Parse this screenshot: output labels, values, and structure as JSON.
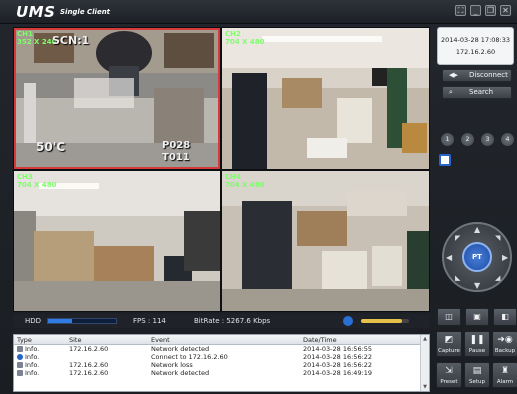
{
  "app": {
    "title": "UMS",
    "subtitle": "Single Client"
  },
  "window_controls": [
    {
      "name": "fullscreen-button",
      "glyph": "⛶"
    },
    {
      "name": "minimize-button",
      "glyph": "_"
    },
    {
      "name": "restore-button",
      "glyph": "❐"
    },
    {
      "name": "close-button",
      "glyph": "✕"
    }
  ],
  "cameras": [
    {
      "label": "CH1",
      "resolution": "352 X 240",
      "osd_top": "SCN:1",
      "osd_left": "50'C",
      "osd_right": "P028",
      "osd_right2": "T011",
      "selected": true
    },
    {
      "label": "CH2",
      "resolution": "704 X 480",
      "selected": false
    },
    {
      "label": "CH3",
      "resolution": "704 X 480",
      "selected": false
    },
    {
      "label": "CH4",
      "resolution": "704 X 480",
      "selected": false
    }
  ],
  "status": {
    "hdd_label": "HDD",
    "hdd_usage": 0.35,
    "fps_text": "FPS : 114",
    "bitrate_text": "BitRate : 5267.6 Kbps",
    "volume": 0.85
  },
  "log": {
    "columns": [
      "Type",
      "Site",
      "Event",
      "Date/Time"
    ],
    "rows": [
      {
        "type": "Info.",
        "icon": "site-icon",
        "site": "172.16.2.60",
        "event": "Network detected",
        "datetime": "2014-03-28 16:56:55"
      },
      {
        "type": "Info.",
        "icon": "info-icon",
        "site": "",
        "event": "Connect to 172.16.2.60",
        "datetime": "2014-03-28 16:56:22"
      },
      {
        "type": "Info.",
        "icon": "site-icon",
        "site": "172.16.2.60",
        "event": "Network loss",
        "datetime": "2014-03-28 16:56:22"
      },
      {
        "type": "Info.",
        "icon": "site-icon",
        "site": "172.16.2.60",
        "event": "Network detected",
        "datetime": "2014-03-28 16:49:19"
      }
    ]
  },
  "info_panel": {
    "datetime": "2014-03-28 17:08:33",
    "site": "172.16.2.60"
  },
  "buttons": {
    "disconnect": "Disconnect",
    "search": "Search"
  },
  "channel_buttons": [
    "1",
    "2",
    "3",
    "4"
  ],
  "ptz": {
    "center_label": "PT"
  },
  "tools": [
    {
      "name": "snapshot-mode-button",
      "glyph": "◫"
    },
    {
      "name": "image-mode-button",
      "glyph": "▣"
    },
    {
      "name": "view-mode-button",
      "glyph": "◧"
    }
  ],
  "actions": [
    {
      "name": "capture-button",
      "label": "Capture",
      "icon": "capture-icon",
      "glyph": "◩"
    },
    {
      "name": "pause-button",
      "label": "Pause",
      "icon": "pause-icon",
      "glyph": "❚❚"
    },
    {
      "name": "backup-button",
      "label": "Backup",
      "icon": "backup-icon",
      "glyph": "➜◉"
    },
    {
      "name": "preset-button",
      "label": "Preset",
      "icon": "preset-icon",
      "glyph": "⇲"
    },
    {
      "name": "setup-button",
      "label": "Setup",
      "icon": "setup-icon",
      "glyph": "▤"
    },
    {
      "name": "alarm-button",
      "label": "Alarm",
      "icon": "alarm-icon",
      "glyph": "♜"
    }
  ],
  "colors": {
    "accent": "#2f7de4",
    "selected_border": "#d63a3a",
    "osd_green": "#7dff6a",
    "volume": "#e4c24a"
  }
}
